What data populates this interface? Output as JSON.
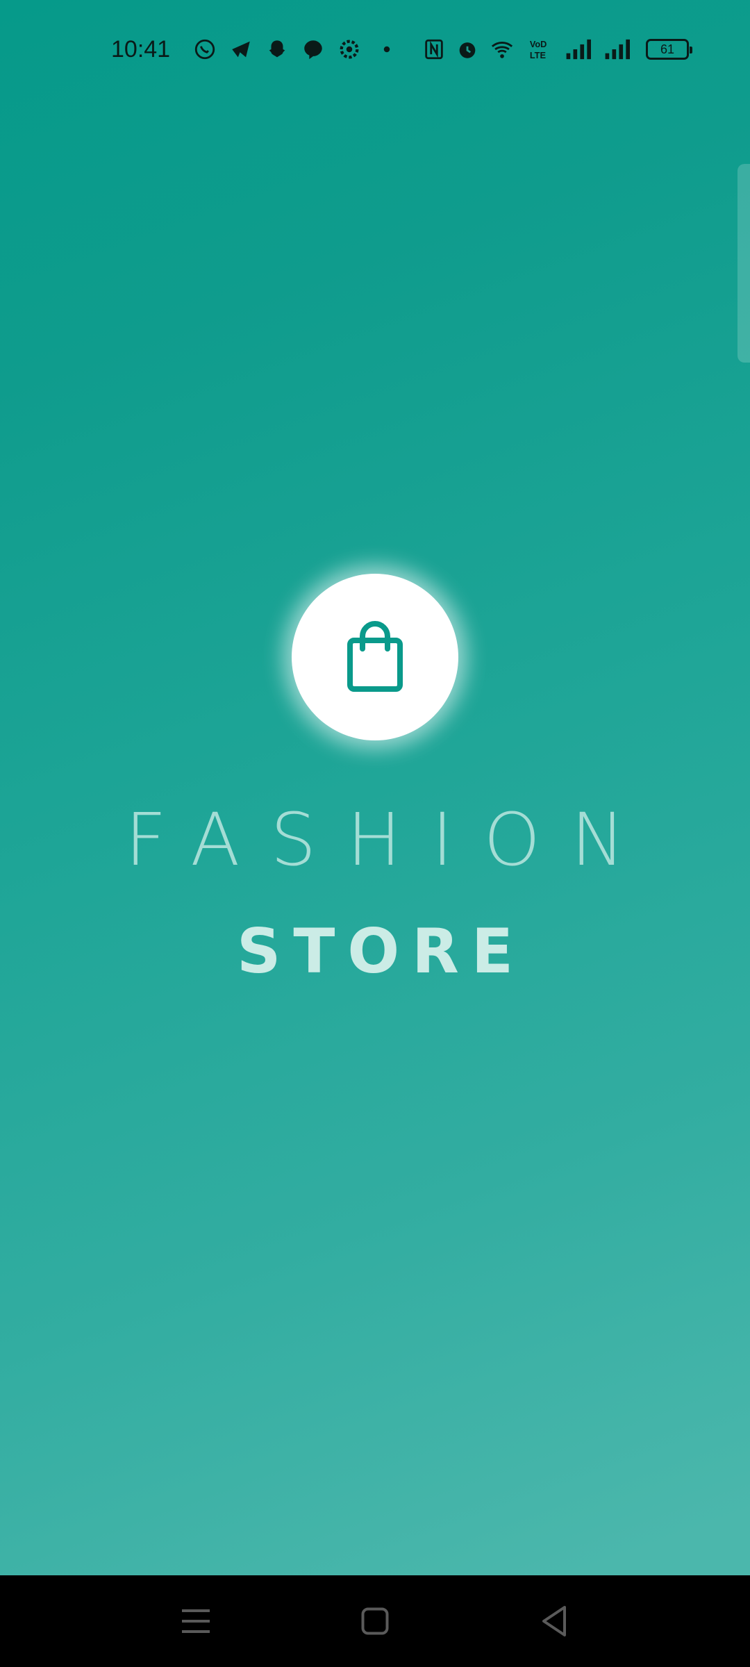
{
  "status_bar": {
    "time": "10:41",
    "battery": "61",
    "icons": [
      "whatsapp-icon",
      "telegram-icon",
      "snapchat-icon",
      "messenger-icon",
      "settings-icon",
      "dot-icon",
      "nfc-icon",
      "alarm-icon",
      "wifi-icon",
      "volte-icon",
      "signal-icon",
      "signal-icon"
    ]
  },
  "logo": {
    "icon": "shopping-bag-icon",
    "accent_color": "#0a9a8b"
  },
  "brand": {
    "line1": "FASHION",
    "line2": "STORE"
  },
  "nav_bar": {
    "buttons": [
      "menu-icon",
      "home-icon",
      "back-icon"
    ]
  }
}
